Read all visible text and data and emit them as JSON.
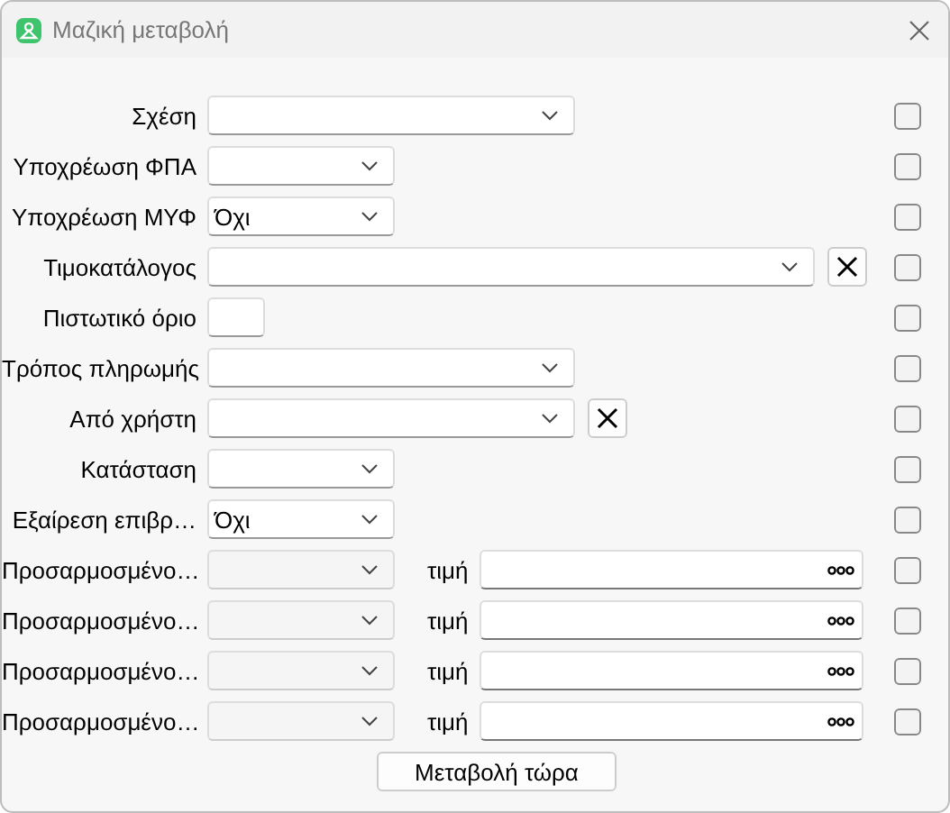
{
  "window": {
    "title": "Μαζική μεταβολή"
  },
  "rows": [
    {
      "kind": "select",
      "label": "Σχέση",
      "value": "",
      "clear": false,
      "checked": false
    },
    {
      "kind": "select",
      "label": "Υποχρέωση ΦΠΑ",
      "value": "",
      "clear": false,
      "checked": false
    },
    {
      "kind": "select",
      "label": "Υποχρέωση ΜΥΦ",
      "value": "Όχι",
      "clear": false,
      "checked": false
    },
    {
      "kind": "select",
      "label": "Τιμοκατάλογος",
      "value": "",
      "clear": true,
      "checked": false
    },
    {
      "kind": "input",
      "label": "Πιστωτικό όριο",
      "checked": false
    },
    {
      "kind": "select",
      "label": "Τρόπος πληρωμής",
      "value": "",
      "clear": false,
      "checked": false
    },
    {
      "kind": "select",
      "label": "Από χρήστη",
      "value": "",
      "clear": true,
      "checked": false
    },
    {
      "kind": "select",
      "label": "Κατάσταση",
      "value": "",
      "clear": false,
      "checked": false
    },
    {
      "kind": "select",
      "label": "Εξαίρεση επιβρ…",
      "value": "Όχι",
      "clear": false,
      "checked": false
    },
    {
      "kind": "custom",
      "label": "Προσαρμοσμένο…",
      "disabled": true,
      "value_label": "τιμή",
      "checked": false
    },
    {
      "kind": "custom",
      "label": "Προσαρμοσμένο…",
      "disabled": true,
      "value_label": "τιμή",
      "checked": false
    },
    {
      "kind": "custom",
      "label": "Προσαρμοσμένο…",
      "disabled": true,
      "value_label": "τιμή",
      "checked": false
    },
    {
      "kind": "custom",
      "label": "Προσαρμοσμένο…",
      "disabled": true,
      "value_label": "τιμή",
      "checked": false
    }
  ],
  "apply_button": "Μεταβολή τώρα"
}
